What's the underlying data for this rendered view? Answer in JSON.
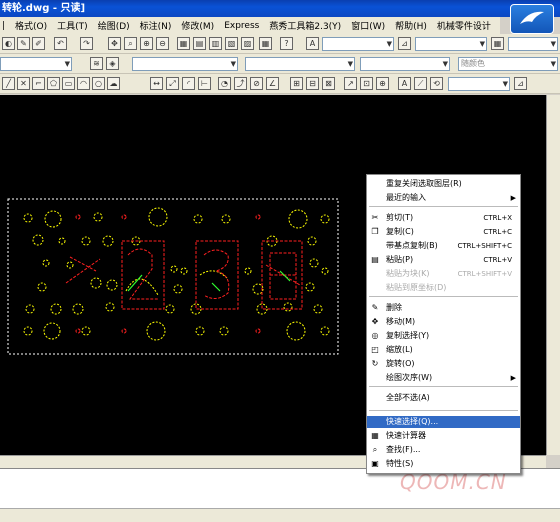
{
  "titlebar": {
    "title": "转轮.dwg - 只读]"
  },
  "menubar": {
    "items": [
      "格式(O)",
      "工具(T)",
      "绘图(D)",
      "标注(N)",
      "修改(M)",
      "Express",
      "燕秀工具箱2.3(Y)",
      "窗口(W)",
      "帮助(H)",
      "机械零件设计"
    ],
    "lead": "|"
  },
  "toolbar": {
    "color_combo": "随颜色"
  },
  "context_menu": {
    "items": [
      {
        "label": "重复关闭选取图层(R)",
        "shortcut": "",
        "arrow": false,
        "disabled": false,
        "icon": ""
      },
      {
        "label": "最近的输入",
        "shortcut": "",
        "arrow": true,
        "disabled": false,
        "icon": ""
      },
      {
        "label": "剪切(T)",
        "shortcut": "CTRL+X",
        "arrow": false,
        "disabled": false,
        "icon": "scissors-icon"
      },
      {
        "label": "复制(C)",
        "shortcut": "CTRL+C",
        "arrow": false,
        "disabled": false,
        "icon": "copy-icon"
      },
      {
        "label": "带基点复制(B)",
        "shortcut": "CTRL+SHIFT+C",
        "arrow": false,
        "disabled": false,
        "icon": ""
      },
      {
        "label": "粘贴(P)",
        "shortcut": "CTRL+V",
        "arrow": false,
        "disabled": false,
        "icon": "paste-icon"
      },
      {
        "label": "粘贴为块(K)",
        "shortcut": "CTRL+SHIFT+V",
        "arrow": false,
        "disabled": true,
        "icon": ""
      },
      {
        "label": "粘贴到原坐标(D)",
        "shortcut": "",
        "arrow": false,
        "disabled": true,
        "icon": ""
      },
      {
        "label": "删除",
        "shortcut": "",
        "arrow": false,
        "disabled": false,
        "icon": "erase-icon"
      },
      {
        "label": "移动(M)",
        "shortcut": "",
        "arrow": false,
        "disabled": false,
        "icon": "move-icon"
      },
      {
        "label": "复制选择(Y)",
        "shortcut": "",
        "arrow": false,
        "disabled": false,
        "icon": "copy-select-icon"
      },
      {
        "label": "缩放(L)",
        "shortcut": "",
        "arrow": false,
        "disabled": false,
        "icon": "scale-icon"
      },
      {
        "label": "旋转(O)",
        "shortcut": "",
        "arrow": false,
        "disabled": false,
        "icon": "rotate-icon"
      },
      {
        "label": "绘图次序(W)",
        "shortcut": "",
        "arrow": true,
        "disabled": false,
        "icon": ""
      },
      {
        "label": "全部不选(A)",
        "shortcut": "",
        "arrow": false,
        "disabled": false,
        "icon": ""
      },
      {
        "label": "快速选择(Q)...",
        "shortcut": "",
        "arrow": false,
        "disabled": false,
        "icon": ""
      },
      {
        "label": "快速计算器",
        "shortcut": "",
        "arrow": false,
        "disabled": false,
        "icon": "calculator-icon"
      },
      {
        "label": "查找(F)...",
        "shortcut": "",
        "arrow": false,
        "disabled": false,
        "icon": "find-icon"
      },
      {
        "label": "特性(S)",
        "shortcut": "",
        "arrow": false,
        "disabled": false,
        "icon": "properties-icon"
      }
    ],
    "highlighted_index": 15
  },
  "watermark": {
    "text": "QOOM.CN"
  },
  "colors": {
    "titlebar": "#0a47c2",
    "highlight": "#316ac5",
    "canvas": "#000000",
    "yellow": "#ffff00",
    "red": "#ff2020"
  }
}
